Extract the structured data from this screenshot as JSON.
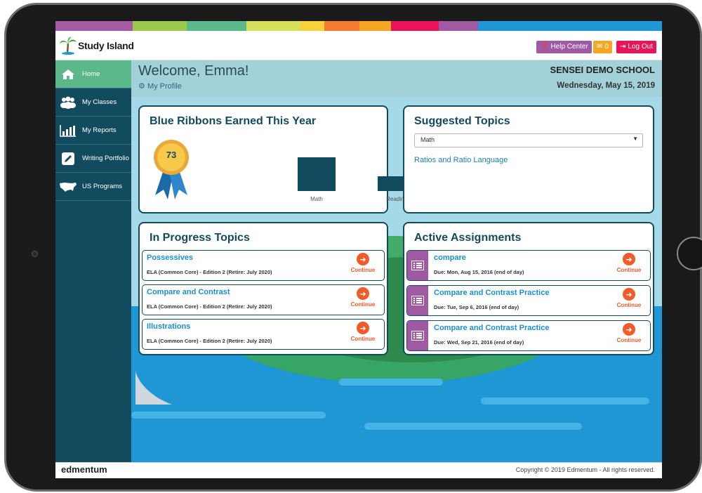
{
  "app": {
    "logo_text": "Study Island",
    "footer_brand": "edmentum",
    "copyright": "Copyright © 2019 Edmentum - All rights reserved."
  },
  "header": {
    "help_label": "Help Center",
    "messages_count": "0",
    "logout_label": "Log Out",
    "welcome": "Welcome, Emma!",
    "profile_link": "My Profile",
    "school": "SENSEI DEMO SCHOOL",
    "date": "Wednesday, May 15, 2019"
  },
  "colors": {
    "accent_green": "#5ab88a",
    "sidebar": "#134b5e",
    "help": "#a05aa3",
    "messages": "#f5a623",
    "logout": "#e8145a",
    "continue": "#f15a29"
  },
  "sidebar": {
    "items": [
      {
        "label": "Home",
        "icon": "home-icon",
        "active": true
      },
      {
        "label": "My Classes",
        "icon": "users-icon",
        "active": false
      },
      {
        "label": "My Reports",
        "icon": "bar-chart-icon",
        "active": false
      },
      {
        "label": "Writing Portfolio",
        "icon": "pencil-icon",
        "active": false
      },
      {
        "label": "US Programs",
        "icon": "us-map-icon",
        "active": false
      }
    ]
  },
  "ribbons": {
    "title": "Blue Ribbons Earned This Year",
    "total": "73",
    "chart_data": {
      "type": "bar",
      "categories": [
        "Math",
        "Reading"
      ],
      "values": [
        48,
        21
      ],
      "ylim": [
        0,
        48
      ]
    }
  },
  "suggested": {
    "title": "Suggested Topics",
    "selected": "Math",
    "topic": "Ratios and Ratio Language"
  },
  "in_progress": {
    "title": "In Progress Topics",
    "continue_label": "Continue",
    "items": [
      {
        "title": "Possessives",
        "sub": "ELA (Common Core) - Edition 2 (Retire: July 2020)"
      },
      {
        "title": "Compare and Contrast",
        "sub": "ELA (Common Core) - Edition 2 (Retire: July 2020)"
      },
      {
        "title": "Illustrations",
        "sub": "ELA (Common Core) - Edition 2 (Retire: July 2020)"
      }
    ]
  },
  "assignments": {
    "title": "Active Assignments",
    "continue_label": "Continue",
    "items": [
      {
        "title": "compare",
        "due": "Due: Mon, Aug 15, 2016 (end of day)"
      },
      {
        "title": "Compare and Contrast Practice",
        "due": "Due: Tue, Sep 6, 2016 (end of day)"
      },
      {
        "title": "Compare and Contrast Practice",
        "due": "Due: Wed, Sep 21, 2016 (end of day)"
      }
    ]
  }
}
